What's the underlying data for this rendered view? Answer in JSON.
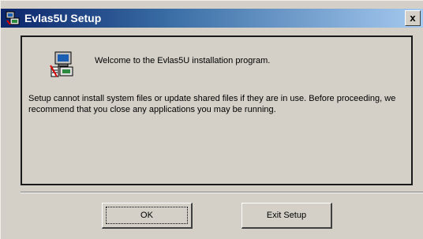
{
  "window": {
    "title": "Evlas5U Setup",
    "close_label": "x"
  },
  "content": {
    "welcome": "Welcome to the Evlas5U installation program.",
    "message": "Setup cannot install system files or update shared files if they are in use.  Before proceeding, we recommend that you close any applications you may be running."
  },
  "buttons": {
    "ok": "OK",
    "exit": "Exit Setup"
  },
  "icons": {
    "app": "setup-computer-icon",
    "dialog": "setup-computer-icon"
  },
  "colors": {
    "titlebar_start": "#0b246a",
    "titlebar_end": "#a6caf0",
    "dialog_face": "#d4d0c8"
  }
}
